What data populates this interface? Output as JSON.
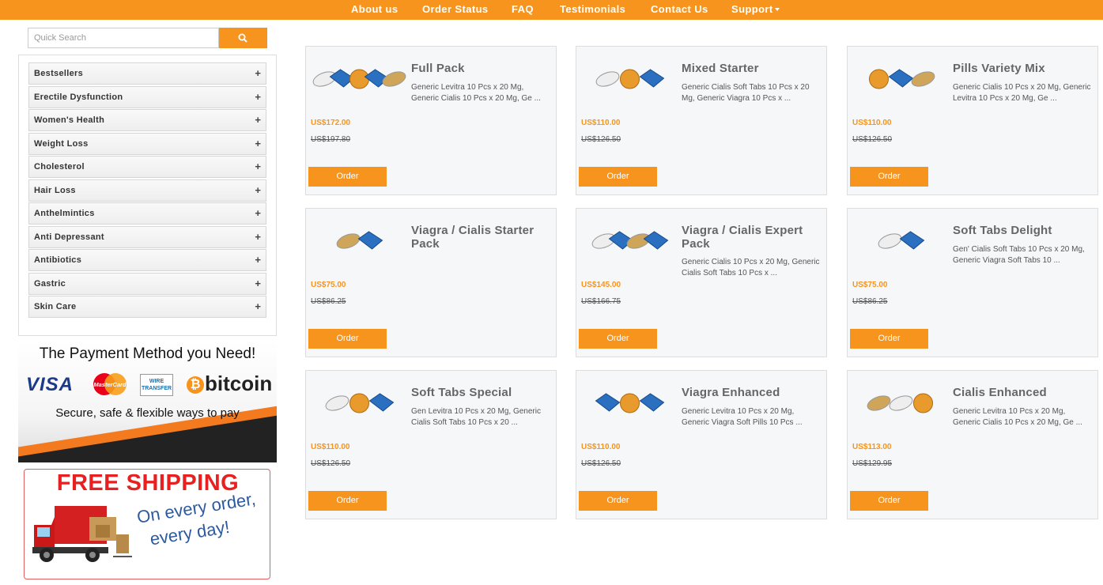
{
  "nav": {
    "about": "About us",
    "order_status": "Order Status",
    "faq": "FAQ",
    "testimonials": "Testimonials",
    "contact": "Contact Us",
    "support": "Support"
  },
  "search": {
    "placeholder": "Quick Search",
    "icon": "search-icon"
  },
  "categories": [
    "Bestsellers",
    "Erectile Dysfunction",
    "Women's Health",
    "Weight Loss",
    "Cholesterol",
    "Hair Loss",
    "Anthelmintics",
    "Anti Depressant",
    "Antibiotics",
    "Gastric",
    "Skin Care"
  ],
  "category_toggle": "+",
  "payment_banner": {
    "title": "The Payment Method you Need!",
    "visa": "VISA",
    "mastercard": "MasterCard",
    "wire": "WIRE TRANSFER",
    "bitcoin": "bitcoin",
    "subtitle": "Secure, safe & flexible ways to pay"
  },
  "shipping_banner": {
    "title": "FREE SHIPPING",
    "line1": "On every order,",
    "line2": "every day!"
  },
  "products": [
    {
      "name": "Full Pack",
      "desc": "Generic Levitra 10 Pcs x 20 Mg, Generic Cialis 10 Pcs x 20 Mg, Ge ...",
      "price": "US$172.00",
      "old_price": "US$197.80",
      "order": "Order"
    },
    {
      "name": "Mixed Starter",
      "desc": "Generic Cialis Soft Tabs 10 Pcs x 20 Mg, Generic Viagra 10 Pcs x ...",
      "price": "US$110.00",
      "old_price": "US$126.50",
      "order": "Order"
    },
    {
      "name": "Pills Variety Mix",
      "desc": "Generic Cialis 10 Pcs x 20 Mg, Generic Levitra 10 Pcs x 20 Mg, Ge ...",
      "price": "US$110.00",
      "old_price": "US$126.50",
      "order": "Order"
    },
    {
      "name": "Viagra / Cialis Starter Pack",
      "desc": "",
      "price": "US$75.00",
      "old_price": "US$86.25",
      "order": "Order"
    },
    {
      "name": "Viagra / Cialis Expert Pack",
      "desc": "Generic Cialis 10 Pcs x 20 Mg, Generic Cialis Soft Tabs 10 Pcs x ...",
      "price": "US$145.00",
      "old_price": "US$166.75",
      "order": "Order"
    },
    {
      "name": "Soft Tabs Delight",
      "desc": "Gen' Cialis Soft Tabs 10 Pcs x 20 Mg, Generic Viagra Soft Tabs 10 ...",
      "price": "US$75.00",
      "old_price": "US$86.25",
      "order": "Order"
    },
    {
      "name": "Soft Tabs Special",
      "desc": "Gen Levitra 10 Pcs x 20 Mg, Generic Cialis Soft Tabs 10 Pcs x 20 ...",
      "price": "US$110.00",
      "old_price": "US$126.50",
      "order": "Order"
    },
    {
      "name": "Viagra Enhanced",
      "desc": "Generic Levitra 10 Pcs x 20 Mg, Generic Viagra Soft Pills 10 Pcs ...",
      "price": "US$110.00",
      "old_price": "US$126.50",
      "order": "Order"
    },
    {
      "name": "Cialis Enhanced",
      "desc": "Generic Levitra 10 Pcs x 20 Mg, Generic Cialis 10 Pcs x 20 Mg, Ge ...",
      "price": "US$113.00",
      "old_price": "US$129.95",
      "order": "Order"
    }
  ],
  "colors": {
    "accent": "#f7941d",
    "card_bg": "#f6f7f9",
    "name_text": "#666666"
  }
}
